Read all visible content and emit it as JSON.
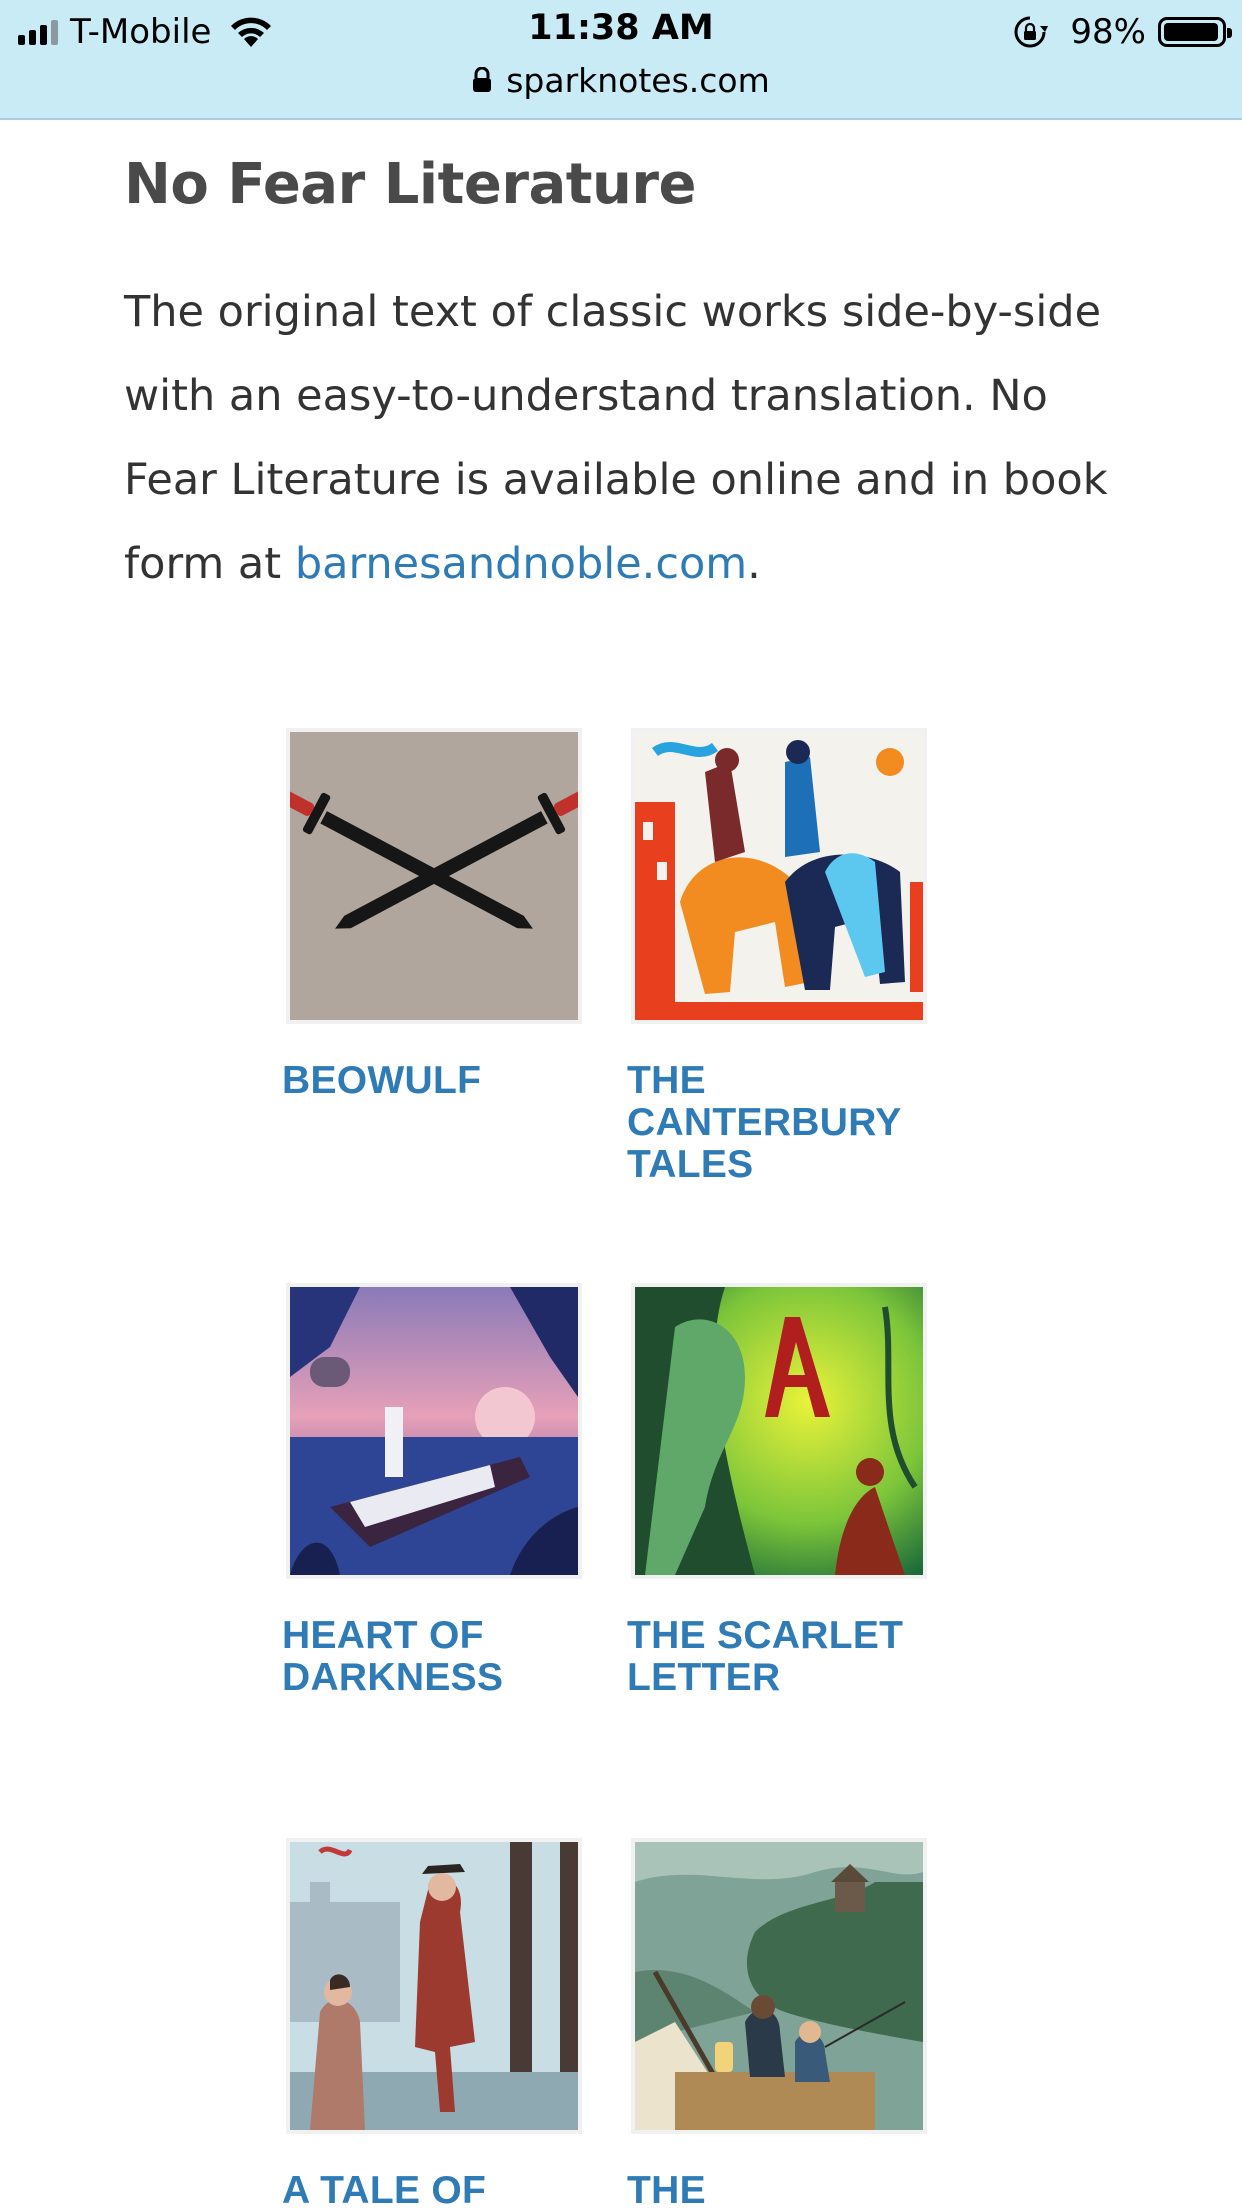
{
  "status_bar": {
    "carrier": "T-Mobile",
    "time": "11:38 AM",
    "battery": "98%",
    "battery_level": 0.98
  },
  "browser": {
    "url": "sparknotes.com"
  },
  "section": {
    "title": "No Fear Literature",
    "intro": "The original text of classic works side-by-side with an easy-to-understand translation. No Fear Literature is available online and in book form at ",
    "link_text": "barnesandnoble.com",
    "intro_end": "."
  },
  "books": [
    {
      "title": "BEOWULF",
      "cover": "crossed-swords-cover"
    },
    {
      "title": "THE CANTERBURY TALES",
      "cover": "pilgrims-on-horses-cover"
    },
    {
      "title": "HEART OF DARKNESS",
      "cover": "steamboat-river-cover"
    },
    {
      "title": "THE SCARLET LETTER",
      "cover": "scarlet-a-cover"
    },
    {
      "title": "A TALE OF",
      "cover": "guillotine-cover"
    },
    {
      "title": "THE",
      "cover": "river-raft-cover"
    }
  ],
  "colors": {
    "link": "#2e7bb5",
    "status_bar_bg": "#c9ebf5"
  }
}
